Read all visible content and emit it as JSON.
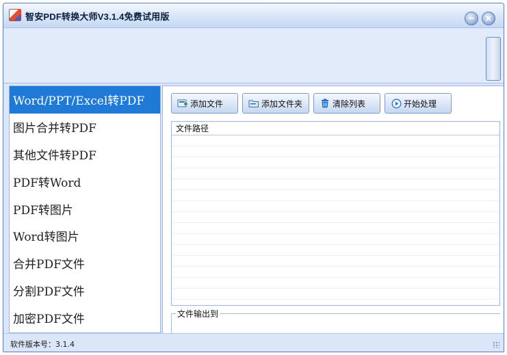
{
  "window": {
    "title": "智安PDF转换大师V3.1.4免费试用版",
    "minimize_glyph": "−",
    "close_glyph": "×"
  },
  "sidebar": {
    "items": [
      {
        "label": "Word/PPT/Excel转PDF",
        "active": true
      },
      {
        "label": "图片合并转PDF",
        "active": false
      },
      {
        "label": "其他文件转PDF",
        "active": false
      },
      {
        "label": "PDF转Word",
        "active": false
      },
      {
        "label": "PDF转图片",
        "active": false
      },
      {
        "label": "Word转图片",
        "active": false
      },
      {
        "label": "合并PDF文件",
        "active": false
      },
      {
        "label": "分割PDF文件",
        "active": false
      },
      {
        "label": "加密PDF文件",
        "active": false
      }
    ]
  },
  "toolbar": {
    "add_file": "添加文件",
    "add_folder": "添加文件夹",
    "clear_list": "清除列表",
    "start": "开始处理"
  },
  "file_list": {
    "column_header": "文件路径",
    "rows": []
  },
  "output": {
    "legend": "文件输出到"
  },
  "status": {
    "version_text": "软件版本号：3.1.4"
  },
  "colors": {
    "accent": "#1e7ad6",
    "window_bg": "#dbe7f8",
    "border": "#9cb6dc"
  },
  "icons": {
    "app": "app-logo-icon",
    "add_file": "add-file-icon",
    "add_folder": "add-folder-icon",
    "clear": "trash-icon",
    "start": "play-circle-icon"
  }
}
